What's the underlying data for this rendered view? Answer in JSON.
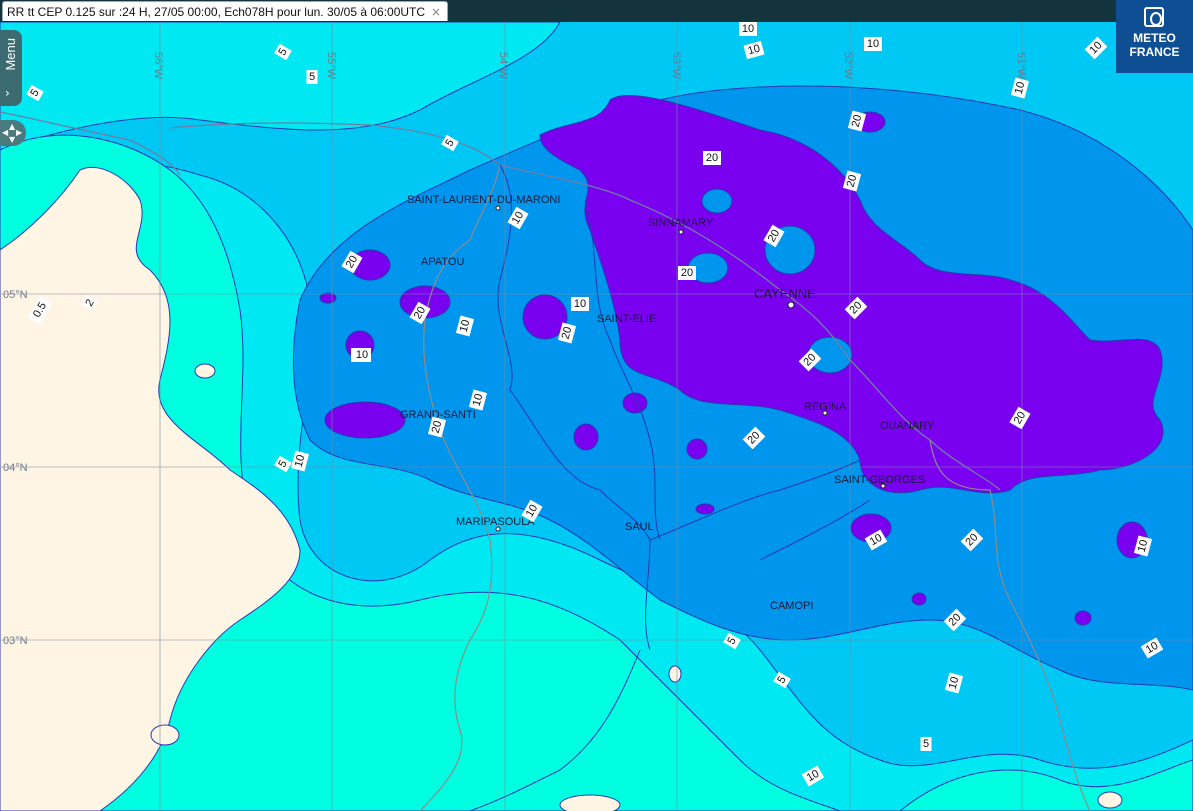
{
  "tab": {
    "title": "RR tt CEP 0.125 sur :24 H, 27/05 00:00, Ech078H pour lun. 30/05 à 06:00UTC",
    "close": "×"
  },
  "menu": {
    "label": "Menu",
    "icon": "chevron-right-icon"
  },
  "nav": {
    "icon": "pan-arrows-icon"
  },
  "logo": {
    "line1": "METEO",
    "line2": "FRANCE",
    "icon": "meteo-france-logo-icon"
  },
  "colors": {
    "bg0": "#fff5e4",
    "c05": "#00ffe0",
    "c2": "#00e8f2",
    "c5": "#00c8f4",
    "c10": "#0096ee",
    "c20": "#7a00f0",
    "outline": "#2838b0"
  },
  "longitudes": [
    "56°W",
    "55°W",
    "54°W",
    "53°W",
    "52°W",
    "51°W"
  ],
  "latitudes": [
    "05°N",
    "04°N",
    "03°N"
  ],
  "cities": [
    {
      "name": "SAINT-LAURENT-DU-MARONI"
    },
    {
      "name": "SINNAMARY"
    },
    {
      "name": "APATOU"
    },
    {
      "name": "CAYENNE"
    },
    {
      "name": "SAINT-ELIE"
    },
    {
      "name": "GRAND-SANTI"
    },
    {
      "name": "REGINA"
    },
    {
      "name": "OUANARY"
    },
    {
      "name": "SAINT-GEORGES"
    },
    {
      "name": "MARIPASOULA"
    },
    {
      "name": "SAUL"
    },
    {
      "name": "CAMOPI"
    }
  ],
  "contour_labels": [
    "5",
    "5",
    "5",
    "5",
    "10",
    "10",
    "10",
    "20",
    "20",
    "20",
    "20",
    "20",
    "20",
    "0.5",
    "2",
    "20",
    "20",
    "10",
    "10",
    "10",
    "20",
    "20",
    "20",
    "20",
    "20",
    "10",
    "5",
    "10",
    "10",
    "20",
    "10",
    "20",
    "10",
    "20",
    "10",
    "10",
    "10",
    "5",
    "5",
    "5",
    "10",
    "10",
    "10"
  ]
}
